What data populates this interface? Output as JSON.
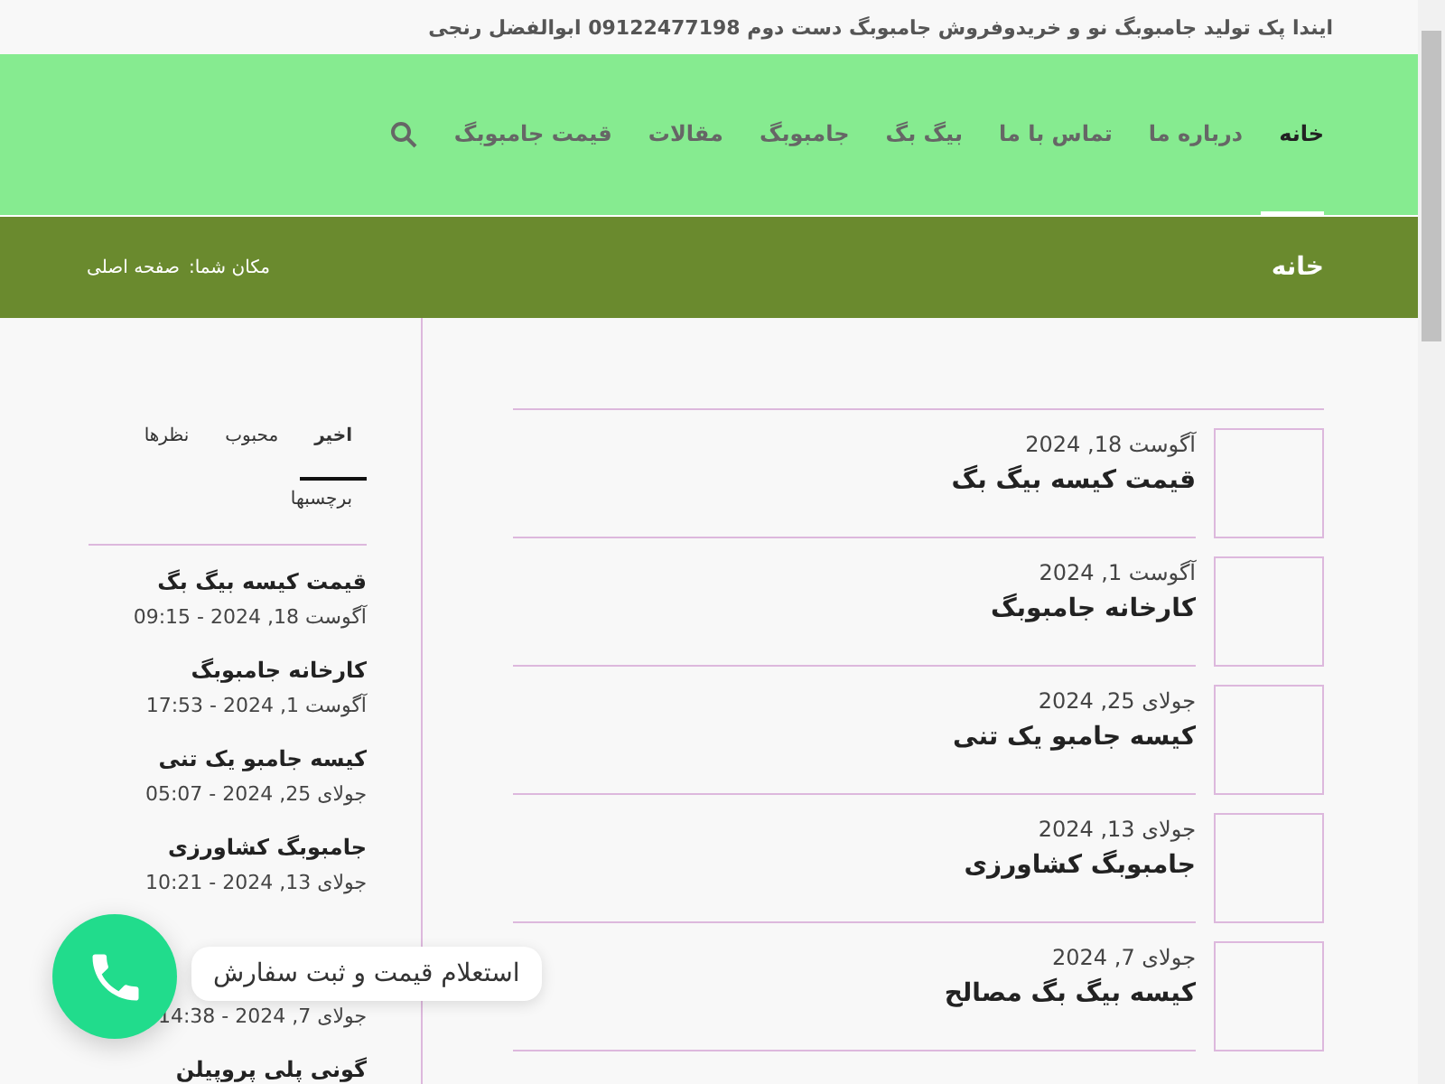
{
  "top_bar": {
    "text": "ایندا پک تولید جامبوبگ نو و خریدوفروش جامبوبگ دست دوم 09122477198 ابوالفضل رنجی"
  },
  "nav": {
    "items": [
      {
        "label": "خانه",
        "selected": true
      },
      {
        "label": "درباره ما",
        "selected": false
      },
      {
        "label": "تماس با ما",
        "selected": false
      },
      {
        "label": "بیگ بگ",
        "selected": false
      },
      {
        "label": "جامبوبگ",
        "selected": false
      },
      {
        "label": "مقالات",
        "selected": false
      },
      {
        "label": "قیمت جامبوبگ",
        "selected": false
      }
    ]
  },
  "title_bar": {
    "title": "خانه",
    "breadcrumb_label": "مکان شما:",
    "breadcrumb": "صفحه اصلی"
  },
  "sidebar": {
    "tabs": [
      {
        "label": "اخیر",
        "selected": true
      },
      {
        "label": "محبوب",
        "selected": false
      },
      {
        "label": "نظرها",
        "selected": false
      },
      {
        "label": "برچسبها",
        "selected": false
      }
    ],
    "posts": [
      {
        "title": "قیمت کیسه بیگ بگ",
        "date": "آگوست 18, 2024 - 09:15"
      },
      {
        "title": "کارخانه جامبوبگ",
        "date": "آگوست 1, 2024 - 17:53"
      },
      {
        "title": "کیسه جامبو یک تنی",
        "date": "جولای 25, 2024 - 05:07"
      },
      {
        "title": "جامبوبگ کشاورزی",
        "date": "جولای 13, 2024 - 10:21"
      },
      {
        "date": "جولای 7, 2024 - 14:38"
      },
      {
        "title": "گونی پلی پروپیلن"
      }
    ]
  },
  "posts": [
    {
      "date": "آگوست 18, 2024",
      "title": "قیمت کیسه بیگ بگ"
    },
    {
      "date": "آگوست 1, 2024",
      "title": "کارخانه جامبوبگ"
    },
    {
      "date": "جولای 25, 2024",
      "title": "کیسه جامبو یک تنی"
    },
    {
      "date": "جولای 13, 2024",
      "title": "جامبوبگ کشاورزی"
    },
    {
      "date": "جولای 7, 2024",
      "title": "کیسه بیگ بگ مصالح"
    }
  ],
  "call_widget": {
    "label": "استعلام قیمت و ثبت سفارش"
  }
}
